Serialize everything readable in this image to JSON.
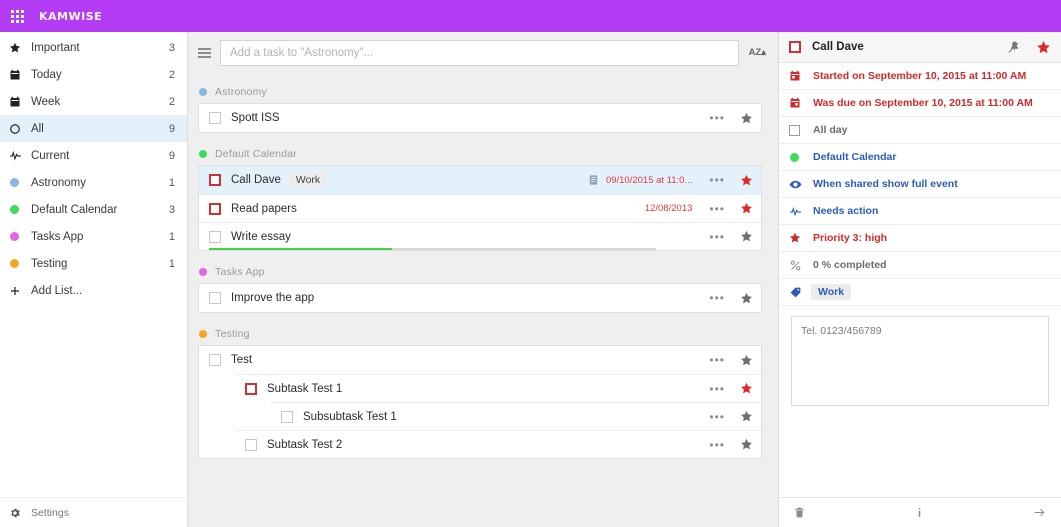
{
  "topbar": {
    "grid_icon": "apps-grid-icon",
    "brand": "KAMWISE"
  },
  "sidebar": {
    "items": [
      {
        "label": "Important",
        "count": "3",
        "icon": "star-icon",
        "color": ""
      },
      {
        "label": "Today",
        "count": "2",
        "icon": "calendar-icon",
        "color": ""
      },
      {
        "label": "Week",
        "count": "2",
        "icon": "calendar-icon",
        "color": ""
      },
      {
        "label": "All",
        "count": "9",
        "icon": "circle-icon",
        "color": ""
      },
      {
        "label": "Current",
        "count": "9",
        "icon": "pulse-icon",
        "color": ""
      },
      {
        "label": "Astronomy",
        "count": "1",
        "icon": "dot-icon",
        "color": "#8ab6e0"
      },
      {
        "label": "Default Calendar",
        "count": "3",
        "icon": "dot-icon",
        "color": "#3ddb5c"
      },
      {
        "label": "Tasks App",
        "count": "1",
        "icon": "dot-icon",
        "color": "#e766e7"
      },
      {
        "label": "Testing",
        "count": "1",
        "icon": "dot-icon",
        "color": "#f5a623"
      }
    ],
    "add_list": {
      "label": "Add List...",
      "icon": "plus-icon"
    },
    "settings": {
      "label": "Settings",
      "icon": "gear-icon"
    }
  },
  "center": {
    "menu_icon": "hamburger-icon",
    "input_placeholder": "Add a task to \"Astronomy\"...",
    "input_value": "",
    "sort_label": "AZ▴",
    "groups": [
      {
        "name": "Astronomy",
        "color": "#8ab6e0",
        "tasks": [
          {
            "title": "Spott ISS",
            "indent": 0,
            "selected": false,
            "checkbox": "empty",
            "tag": "",
            "due": "",
            "has_note": false,
            "starred": false,
            "progress": null,
            "menu": "•••"
          }
        ]
      },
      {
        "name": "Default Calendar",
        "color": "#3ddb5c",
        "tasks": [
          {
            "title": "Call Dave",
            "indent": 0,
            "selected": true,
            "checkbox": "red",
            "tag": "Work",
            "due": "09/10/2015 at 11:0...",
            "has_note": true,
            "starred": true,
            "progress": null,
            "menu": "•••"
          },
          {
            "title": "Read papers",
            "indent": 0,
            "selected": false,
            "checkbox": "red",
            "tag": "",
            "due": "12/08/2013",
            "has_note": false,
            "starred": true,
            "progress": null,
            "menu": "•••"
          },
          {
            "title": "Write essay",
            "indent": 0,
            "selected": false,
            "checkbox": "empty",
            "tag": "",
            "due": "",
            "has_note": false,
            "starred": false,
            "progress": 41,
            "menu": "•••"
          }
        ]
      },
      {
        "name": "Tasks App",
        "color": "#e766e7",
        "tasks": [
          {
            "title": "Improve the app",
            "indent": 0,
            "selected": false,
            "checkbox": "empty",
            "tag": "",
            "due": "",
            "has_note": false,
            "starred": false,
            "progress": null,
            "menu": "•••"
          }
        ]
      },
      {
        "name": "Testing",
        "color": "#f5a623",
        "tasks": [
          {
            "title": "Test",
            "indent": 0,
            "selected": false,
            "checkbox": "empty",
            "tag": "",
            "due": "",
            "has_note": false,
            "starred": false,
            "progress": null,
            "menu": "•••"
          },
          {
            "title": "Subtask Test 1",
            "indent": 1,
            "selected": false,
            "checkbox": "red",
            "tag": "",
            "due": "",
            "has_note": false,
            "starred": true,
            "progress": null,
            "menu": "•••"
          },
          {
            "title": "Subsubtask Test 1",
            "indent": 2,
            "selected": false,
            "checkbox": "empty",
            "tag": "",
            "due": "",
            "has_note": false,
            "starred": false,
            "progress": null,
            "menu": "•••"
          },
          {
            "title": "Subtask Test 2",
            "indent": 1,
            "selected": false,
            "checkbox": "empty",
            "tag": "",
            "due": "",
            "has_note": false,
            "starred": false,
            "progress": null,
            "menu": "•••"
          }
        ]
      }
    ]
  },
  "detail": {
    "title": "Call Dave",
    "checkbox": "red",
    "pin_icon": "pin-off-icon",
    "star_icon": "star-icon",
    "starred": true,
    "rows": [
      {
        "label": "Started on September 10, 2015 at 11:00 AM",
        "icon": "calendar-start-icon",
        "style": "red"
      },
      {
        "label": "Was due on September 10, 2015 at 11:00 AM",
        "icon": "calendar-due-icon",
        "style": "red"
      },
      {
        "label": "All day",
        "icon": "checkbox-icon",
        "style": "grey"
      },
      {
        "label": "Default Calendar",
        "icon": "dot-icon",
        "style": "blue",
        "color": "#3ddb5c"
      },
      {
        "label": "When shared show full event",
        "icon": "eye-icon",
        "style": "blue"
      },
      {
        "label": "Needs action",
        "icon": "pulse-icon",
        "style": "blue"
      },
      {
        "label": "Priority 3: high",
        "icon": "star-icon",
        "style": "red"
      },
      {
        "label": "0 % completed",
        "icon": "percent-icon",
        "style": "grey"
      },
      {
        "label": "Work",
        "icon": "tag-icon",
        "style": "tag"
      }
    ],
    "notes_value": "Tel. 0123/456789",
    "notes_placeholder": "",
    "footer": [
      {
        "icon": "trash-icon"
      },
      {
        "icon": "info-icon"
      },
      {
        "icon": "arrow-right-icon"
      }
    ]
  }
}
